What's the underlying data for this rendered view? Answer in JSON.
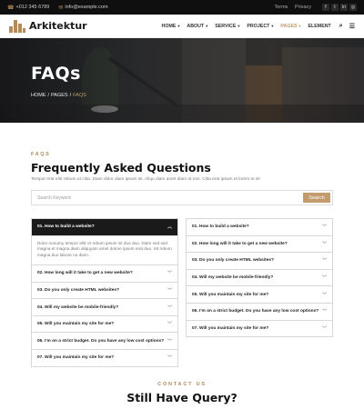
{
  "topbar": {
    "phone_icon": "phone-icon",
    "phone": "+012 345 6789",
    "email_icon": "mail-icon",
    "email": "info@example.com",
    "links": [
      "Terms",
      "Privacy"
    ],
    "social": [
      {
        "icon": "facebook-icon",
        "glyph": "f"
      },
      {
        "icon": "twitter-icon",
        "glyph": "t"
      },
      {
        "icon": "linkedin-icon",
        "glyph": "in"
      },
      {
        "icon": "instagram-icon",
        "glyph": "◎"
      }
    ]
  },
  "nav": {
    "logo_text": "Arkitektur",
    "items": [
      {
        "label": "HOME"
      },
      {
        "label": "ABOUT"
      },
      {
        "label": "SERVICE"
      },
      {
        "label": "PROJECT"
      },
      {
        "label": "PAGES"
      },
      {
        "label": "ELEMENT"
      }
    ],
    "active_index": 4,
    "accent": "#c09a6b"
  },
  "hero": {
    "title": "FAQs",
    "crumbs": [
      "HOME",
      "PAGES",
      "FAQS"
    ]
  },
  "faq_section": {
    "eyebrow": "FAQS",
    "heading": "Frequently Asked Questions",
    "intro": "Tempor erat elitr rebum at clita. Diam dolor diam ipsum sit. Aliqu diam amet diam et eos. Clita erat ipsum et lorem et sit",
    "search_placeholder": "Search Keyword",
    "search_button": "Search",
    "left": [
      {
        "q": "01. How to build a website?",
        "open": true,
        "a": "Dolor nonumy tempor elitr et rebum ipsum sit duo duo. Diam sed sed magna et magna diam aliquyam amet dolore ipsum erat duo. Sit rebum magna duo labore no diam."
      },
      {
        "q": "02. How long will it take to get a new website?"
      },
      {
        "q": "03. Do you only create HTML websites?"
      },
      {
        "q": "04. Will my website be mobile-friendly?"
      },
      {
        "q": "05. Will you maintain my site for me?"
      },
      {
        "q": "06. I'm on a strict budget. Do you have any low cost options?"
      },
      {
        "q": "07. Will you maintain my site for me?"
      }
    ],
    "right": [
      {
        "q": "01. How to build a website?"
      },
      {
        "q": "02. How long will it take to get a new website?"
      },
      {
        "q": "03. Do you only create HTML websites?"
      },
      {
        "q": "04. Will my website be mobile-friendly?"
      },
      {
        "q": "05. Will you maintain my site for me?"
      },
      {
        "q": "06. I'm on a strict budget. Do you have any low cost options?"
      },
      {
        "q": "07. Will you maintain my site for me?"
      }
    ]
  },
  "contact": {
    "eyebrow": "CONTACT US",
    "title": "Still Have Query?"
  }
}
